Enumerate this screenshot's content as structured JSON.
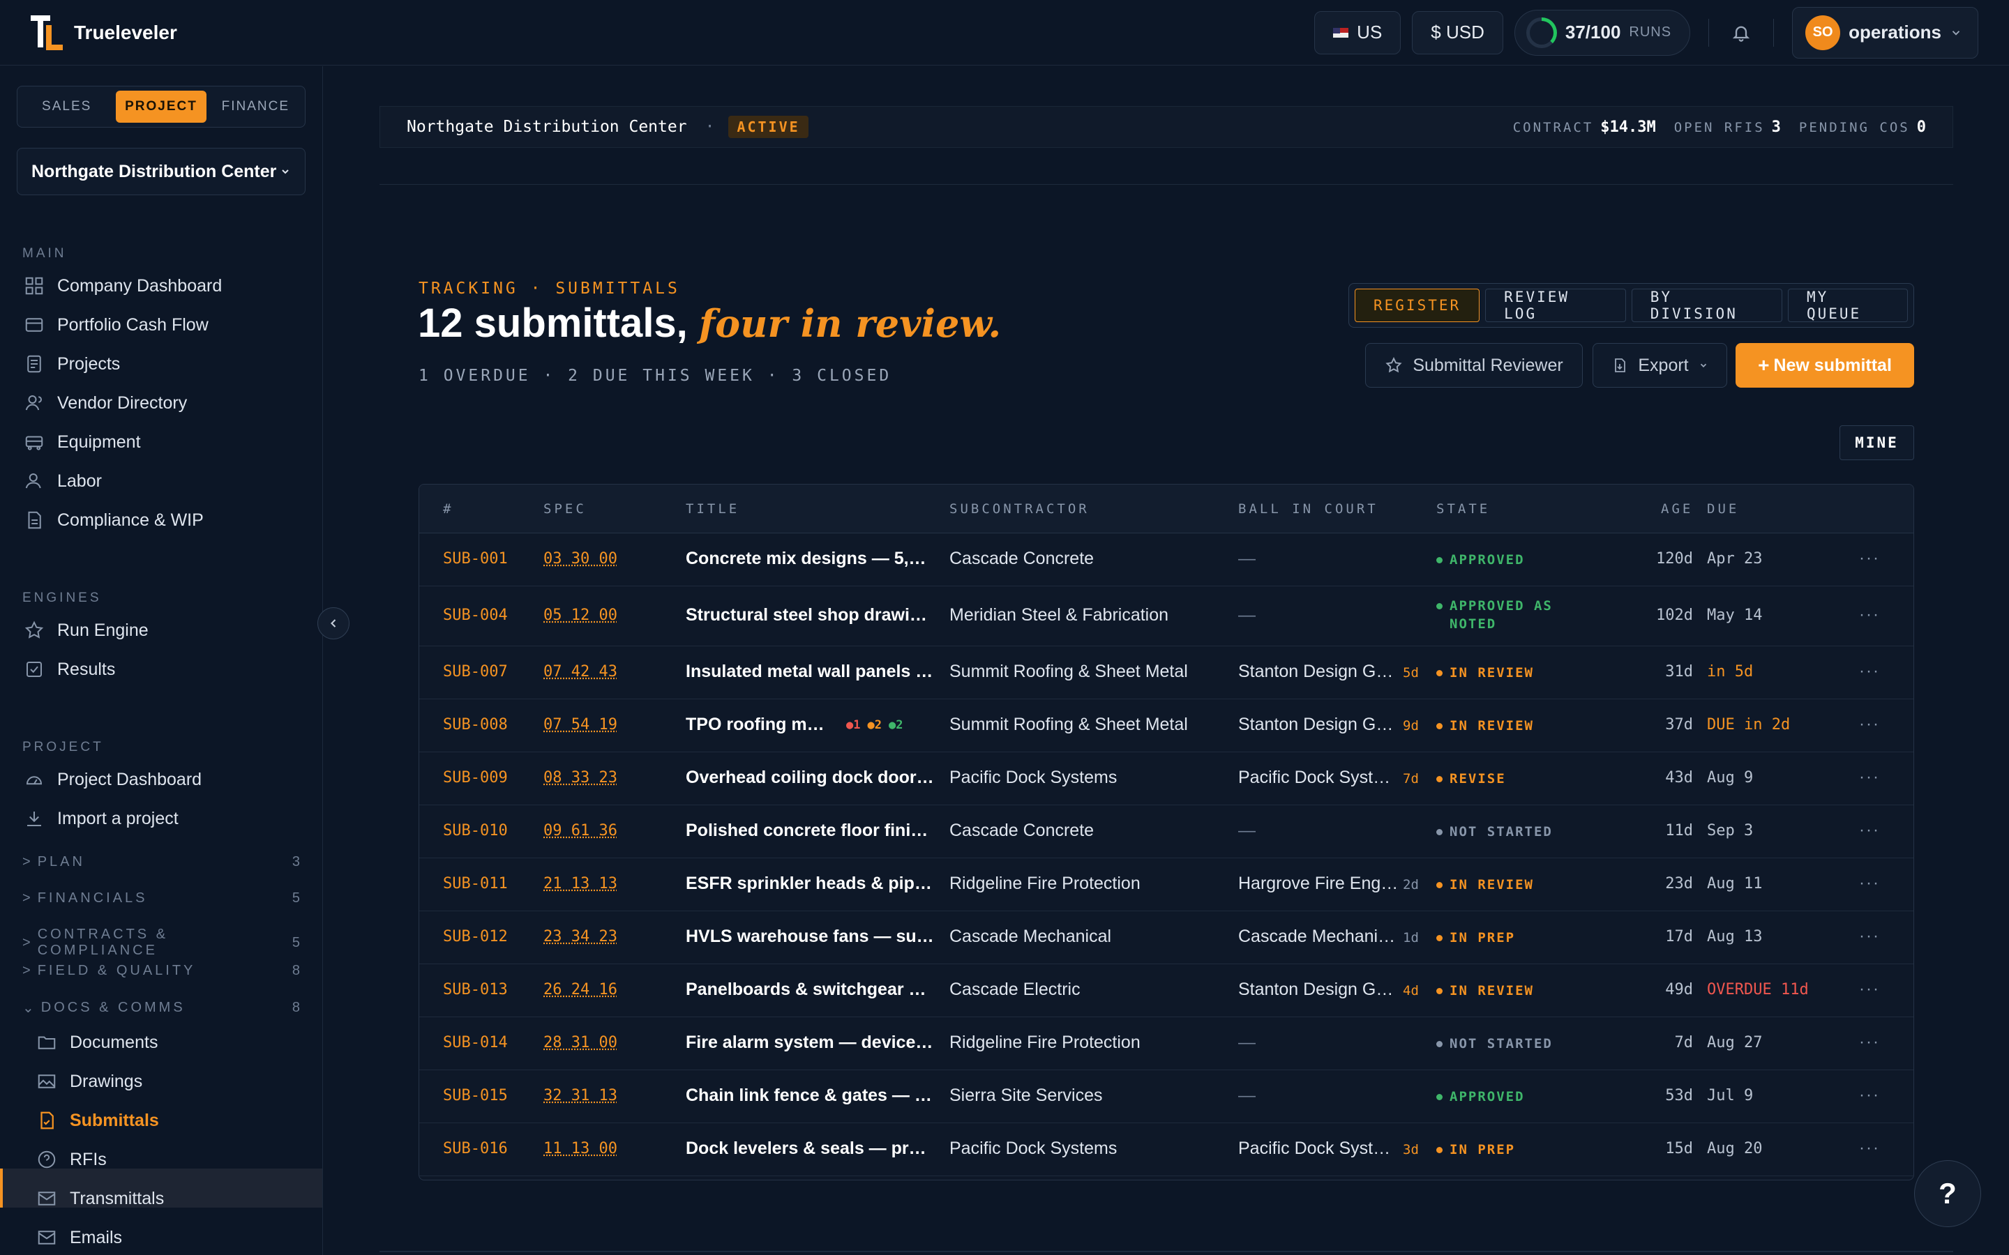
{
  "brand": {
    "name": "Trueleveler"
  },
  "topbar": {
    "region": "US",
    "currency": "$ USD",
    "runs_value": "37/100",
    "runs_label": "RUNS",
    "runs_progress": 0.37,
    "user_initials": "SO",
    "user_name": "operations"
  },
  "sidebar": {
    "modes": [
      "SALES",
      "PROJECT",
      "FINANCE"
    ],
    "active_mode": "PROJECT",
    "project_selector": "Northgate Distribution Center",
    "main_label": "MAIN",
    "main_items": [
      {
        "label": "Company Dashboard",
        "icon": "grid-icon"
      },
      {
        "label": "Portfolio Cash Flow",
        "icon": "wallet-icon"
      },
      {
        "label": "Projects",
        "icon": "document-icon"
      },
      {
        "label": "Vendor Directory",
        "icon": "users-icon"
      },
      {
        "label": "Equipment",
        "icon": "truck-icon"
      },
      {
        "label": "Labor",
        "icon": "user-icon"
      },
      {
        "label": "Compliance & WIP",
        "icon": "file-icon"
      }
    ],
    "engines_label": "ENGINES",
    "engine_items": [
      {
        "label": "Run Engine",
        "icon": "star-icon"
      },
      {
        "label": "Results",
        "icon": "check-square-icon"
      }
    ],
    "project_label": "PROJECT",
    "project_items": [
      {
        "label": "Project Dashboard",
        "icon": "gauge-icon"
      },
      {
        "label": "Import a project",
        "icon": "download-icon"
      }
    ],
    "groups": [
      {
        "label": "PLAN",
        "count": "3"
      },
      {
        "label": "FINANCIALS",
        "count": "5"
      },
      {
        "label": "CONTRACTS & COMPLIANCE",
        "count": "5"
      },
      {
        "label": "FIELD & QUALITY",
        "count": "8"
      },
      {
        "label": "DOCS & COMMS",
        "count": "8"
      }
    ],
    "docs_items": [
      {
        "label": "Documents",
        "icon": "folder-icon"
      },
      {
        "label": "Drawings",
        "icon": "image-icon"
      },
      {
        "label": "Submittals",
        "icon": "file-check-icon"
      },
      {
        "label": "RFIs",
        "icon": "help-circle-icon"
      },
      {
        "label": "Transmittals",
        "icon": "mail-icon"
      },
      {
        "label": "Emails",
        "icon": "envelope-icon"
      }
    ]
  },
  "project_bar": {
    "name": "Northgate Distribution Center",
    "sep": "·",
    "status": "ACTIVE",
    "contract_label": "CONTRACT",
    "contract_value": "$14.3M",
    "rfis_label": "OPEN RFIS",
    "rfis_value": "3",
    "cos_label": "PENDING COS",
    "cos_value": "0"
  },
  "header": {
    "eyebrow": "TRACKING · SUBMITTALS",
    "title_main": "12 submittals,",
    "title_accent": "four in review.",
    "subline": "1 OVERDUE · 2 DUE THIS WEEK · 3 CLOSED"
  },
  "view_tabs": [
    "REGISTER",
    "REVIEW LOG",
    "BY DIVISION",
    "MY QUEUE"
  ],
  "actions": {
    "reviewer": "Submittal Reviewer",
    "export": "Export",
    "new": "New submittal",
    "mine": "MINE"
  },
  "table": {
    "columns": [
      "#",
      "SPEC",
      "TITLE",
      "SUBCONTRACTOR",
      "BALL IN COURT",
      "STATE",
      "AGE",
      "DUE"
    ],
    "rows": [
      {
        "id": "SUB-001",
        "spec": "03 30 00",
        "title": "Concrete mix designs — 5,0…",
        "sub": "Cascade Concrete",
        "bic": "—",
        "bic_days": "",
        "state": "APPROVED",
        "state2": "",
        "age": "120d",
        "due": "Apr 23"
      },
      {
        "id": "SUB-004",
        "spec": "05 12 00",
        "title": "Structural steel shop drawin…",
        "sub": "Meridian Steel & Fabrication",
        "bic": "—",
        "bic_days": "",
        "state": "APPROVED AS",
        "state2": "NOTED",
        "age": "102d",
        "due": "May 14"
      },
      {
        "id": "SUB-007",
        "spec": "07 42 43",
        "title": "Insulated metal wall panels …",
        "sub": "Summit Roofing & Sheet Metal",
        "bic": "Stanton Design G…",
        "bic_days": "5d",
        "state": "IN REVIEW",
        "state2": "",
        "age": "31d",
        "due": "in 5d"
      },
      {
        "id": "SUB-008",
        "spec": "07 54 19",
        "title": "TPO roofing me…",
        "sub": "Summit Roofing & Sheet Metal",
        "bic": "Stanton Design G…",
        "bic_days": "9d",
        "state": "IN REVIEW",
        "state2": "",
        "age": "37d",
        "due": "DUE in 2d",
        "badges": [
          "1",
          "2",
          "2"
        ]
      },
      {
        "id": "SUB-009",
        "spec": "08 33 23",
        "title": "Overhead coiling dock doors…",
        "sub": "Pacific Dock Systems",
        "bic": "Pacific Dock Syst…",
        "bic_days": "7d",
        "state": "REVISE",
        "state2": "",
        "age": "43d",
        "due": "Aug 9"
      },
      {
        "id": "SUB-010",
        "spec": "09 61 36",
        "title": "Polished concrete floor finis…",
        "sub": "Cascade Concrete",
        "bic": "—",
        "bic_days": "",
        "state": "NOT STARTED",
        "state2": "",
        "age": "11d",
        "due": "Sep 3"
      },
      {
        "id": "SUB-011",
        "spec": "21 13 13",
        "title": "ESFR sprinkler heads & pipin…",
        "sub": "Ridgeline Fire Protection",
        "bic": "Hargrove Fire Engi…",
        "bic_days": "2d",
        "state": "IN REVIEW",
        "state2": "",
        "age": "23d",
        "due": "Aug 11"
      },
      {
        "id": "SUB-012",
        "spec": "23 34 23",
        "title": "HVLS warehouse fans — sub…",
        "sub": "Cascade Mechanical",
        "bic": "Cascade Mechani…",
        "bic_days": "1d",
        "state": "IN PREP",
        "state2": "",
        "age": "17d",
        "due": "Aug 13"
      },
      {
        "id": "SUB-013",
        "spec": "26 24 16",
        "title": "Panelboards & switchgear —…",
        "sub": "Cascade Electric",
        "bic": "Stanton Design G…",
        "bic_days": "4d",
        "state": "IN REVIEW",
        "state2": "",
        "age": "49d",
        "due": "OVERDUE 11d"
      },
      {
        "id": "SUB-014",
        "spec": "28 31 00",
        "title": "Fire alarm system — device l…",
        "sub": "Ridgeline Fire Protection",
        "bic": "—",
        "bic_days": "",
        "state": "NOT STARTED",
        "state2": "",
        "age": "7d",
        "due": "Aug 27"
      },
      {
        "id": "SUB-015",
        "spec": "32 31 13",
        "title": "Chain link fence & gates — p…",
        "sub": "Sierra Site Services",
        "bic": "—",
        "bic_days": "",
        "state": "APPROVED",
        "state2": "",
        "age": "53d",
        "due": "Jul 9"
      },
      {
        "id": "SUB-016",
        "spec": "11 13 00",
        "title": "Dock levelers & seals — prod…",
        "sub": "Pacific Dock Systems",
        "bic": "Pacific Dock Syst…",
        "bic_days": "3d",
        "state": "IN PREP",
        "state2": "",
        "age": "15d",
        "due": "Aug 20"
      }
    ],
    "more_label": "···"
  },
  "help_label": "?",
  "colors": {
    "accent": "#f59322",
    "approved": "#3fb66a",
    "review": "#f59322",
    "overdue": "#f0574f",
    "neutral": "#8896aa"
  }
}
